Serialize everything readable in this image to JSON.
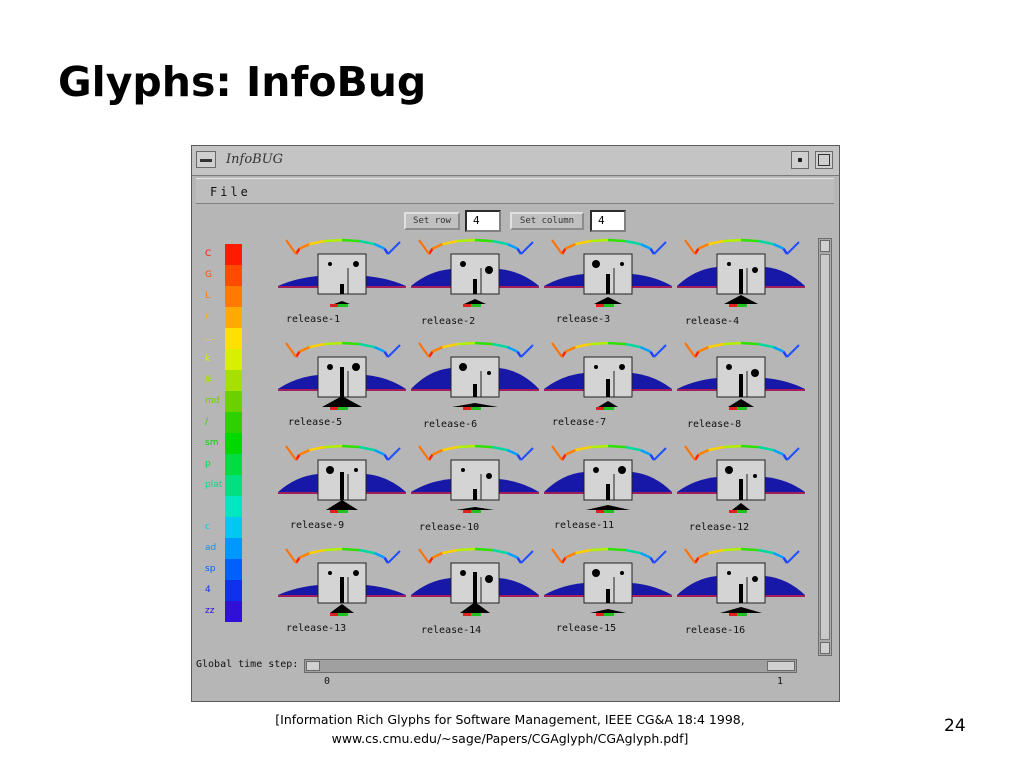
{
  "slide": {
    "title": "Glyphs: InfoBug",
    "caption_line1": "[Information Rich Glyphs for Software Management, IEEE CG&A 18:4 1998,",
    "caption_line2": "www.cs.cmu.edu/~sage/Papers/CGAglyph/CGAglyph.pdf]",
    "page_number": "24"
  },
  "window": {
    "title": "InfoBUG",
    "menu_file": "File",
    "set_row_label": "Set row",
    "set_row_value": "4",
    "set_column_label": "Set column",
    "set_column_value": "4",
    "slider_label": "Global time step:",
    "slider_min": "0",
    "slider_max": "1",
    "slider_value": 1
  },
  "legend": {
    "labels": [
      "C",
      "G",
      "L",
      "r",
      "...",
      "k",
      "lk",
      "md",
      "/",
      "sm",
      "p",
      "plat",
      "",
      "c",
      "ad",
      "sp",
      "4",
      "zz"
    ],
    "colors": [
      "#ff1a00",
      "#ff4a00",
      "#ff7a00",
      "#ffaa00",
      "#ffe000",
      "#d8f000",
      "#a6e000",
      "#6ad000",
      "#30d000",
      "#00d800",
      "#00dd40",
      "#00e080",
      "#00e8c0",
      "#00c8f0",
      "#0098ff",
      "#0060ff",
      "#1030f0",
      "#3010d8"
    ]
  },
  "glyphs": [
    {
      "label": "release-1"
    },
    {
      "label": "release-2"
    },
    {
      "label": "release-3"
    },
    {
      "label": "release-4"
    },
    {
      "label": "release-5"
    },
    {
      "label": "release-6"
    },
    {
      "label": "release-7"
    },
    {
      "label": "release-8"
    },
    {
      "label": "release-9"
    },
    {
      "label": "release-10"
    },
    {
      "label": "release-11"
    },
    {
      "label": "release-12"
    },
    {
      "label": "release-13"
    },
    {
      "label": "release-14"
    },
    {
      "label": "release-15"
    },
    {
      "label": "release-16"
    }
  ],
  "colors": {
    "window_bg": "#b6b6b6",
    "glyph_bg": "#d2d2d2",
    "wing_blue": "#2020c0",
    "tail_black": "#000000",
    "accent_red": "#e02020",
    "accent_green": "#20c020"
  }
}
